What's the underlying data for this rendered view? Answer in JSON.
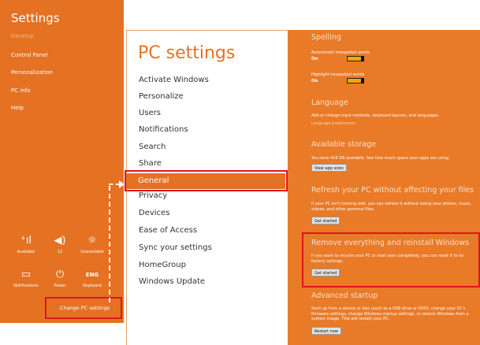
{
  "charms": {
    "title": "Settings",
    "links": [
      "Desktop",
      "Control Panel",
      "Personalization",
      "PC info",
      "Help"
    ],
    "tray": [
      {
        "icon": "network-icon",
        "glyph": "⁺ıl",
        "label": "Available"
      },
      {
        "icon": "volume-icon",
        "glyph": "◀)",
        "label": "12"
      },
      {
        "icon": "brightness-icon",
        "glyph": "☼",
        "label": "Unavailable"
      },
      {
        "icon": "notifications-icon",
        "glyph": "▭",
        "label": "Notifications"
      },
      {
        "icon": "power-icon",
        "glyph": "⏻",
        "label": "Power"
      },
      {
        "icon": "keyboard-icon",
        "glyph": "ENG",
        "label": "Keyboard"
      }
    ],
    "change_pc_settings": "Change PC settings"
  },
  "pc_settings": {
    "title": "PC settings",
    "nav": [
      "Activate Windows",
      "Personalize",
      "Users",
      "Notifications",
      "Search",
      "Share",
      "General",
      "Privacy",
      "Devices",
      "Ease of Access",
      "Sync your settings",
      "HomeGroup",
      "Windows Update"
    ],
    "selected": "General"
  },
  "general": {
    "spelling": {
      "heading": "Spelling",
      "autocorrect_label": "Autocorrect misspelled words",
      "autocorrect_value": "On",
      "highlight_label": "Highlight misspelled words",
      "highlight_value": "On"
    },
    "language": {
      "heading": "Language",
      "desc": "Add or change input methods, keyboard layouts, and languages.",
      "link": "Language preferences"
    },
    "storage": {
      "heading": "Available storage",
      "desc": "You have 416 GB available. See how much space your apps are using.",
      "button": "View app sizes"
    },
    "refresh": {
      "heading": "Refresh your PC without affecting your files",
      "desc": "If your PC isn't running well, you can refresh it without losing your photos, music, videos, and other personal files.",
      "button": "Get started"
    },
    "reset": {
      "heading": "Remove everything and reinstall Windows",
      "desc": "If you want to recycle your PC or start over completely, you can reset it to its factory settings.",
      "button": "Get started"
    },
    "advanced": {
      "heading": "Advanced startup",
      "desc": "Start up from a device or disc (such as a USB drive or DVD), change your PC's firmware settings, change Windows startup settings, or restore Windows from a system image. This will restart your PC.",
      "button": "Restart now"
    }
  }
}
